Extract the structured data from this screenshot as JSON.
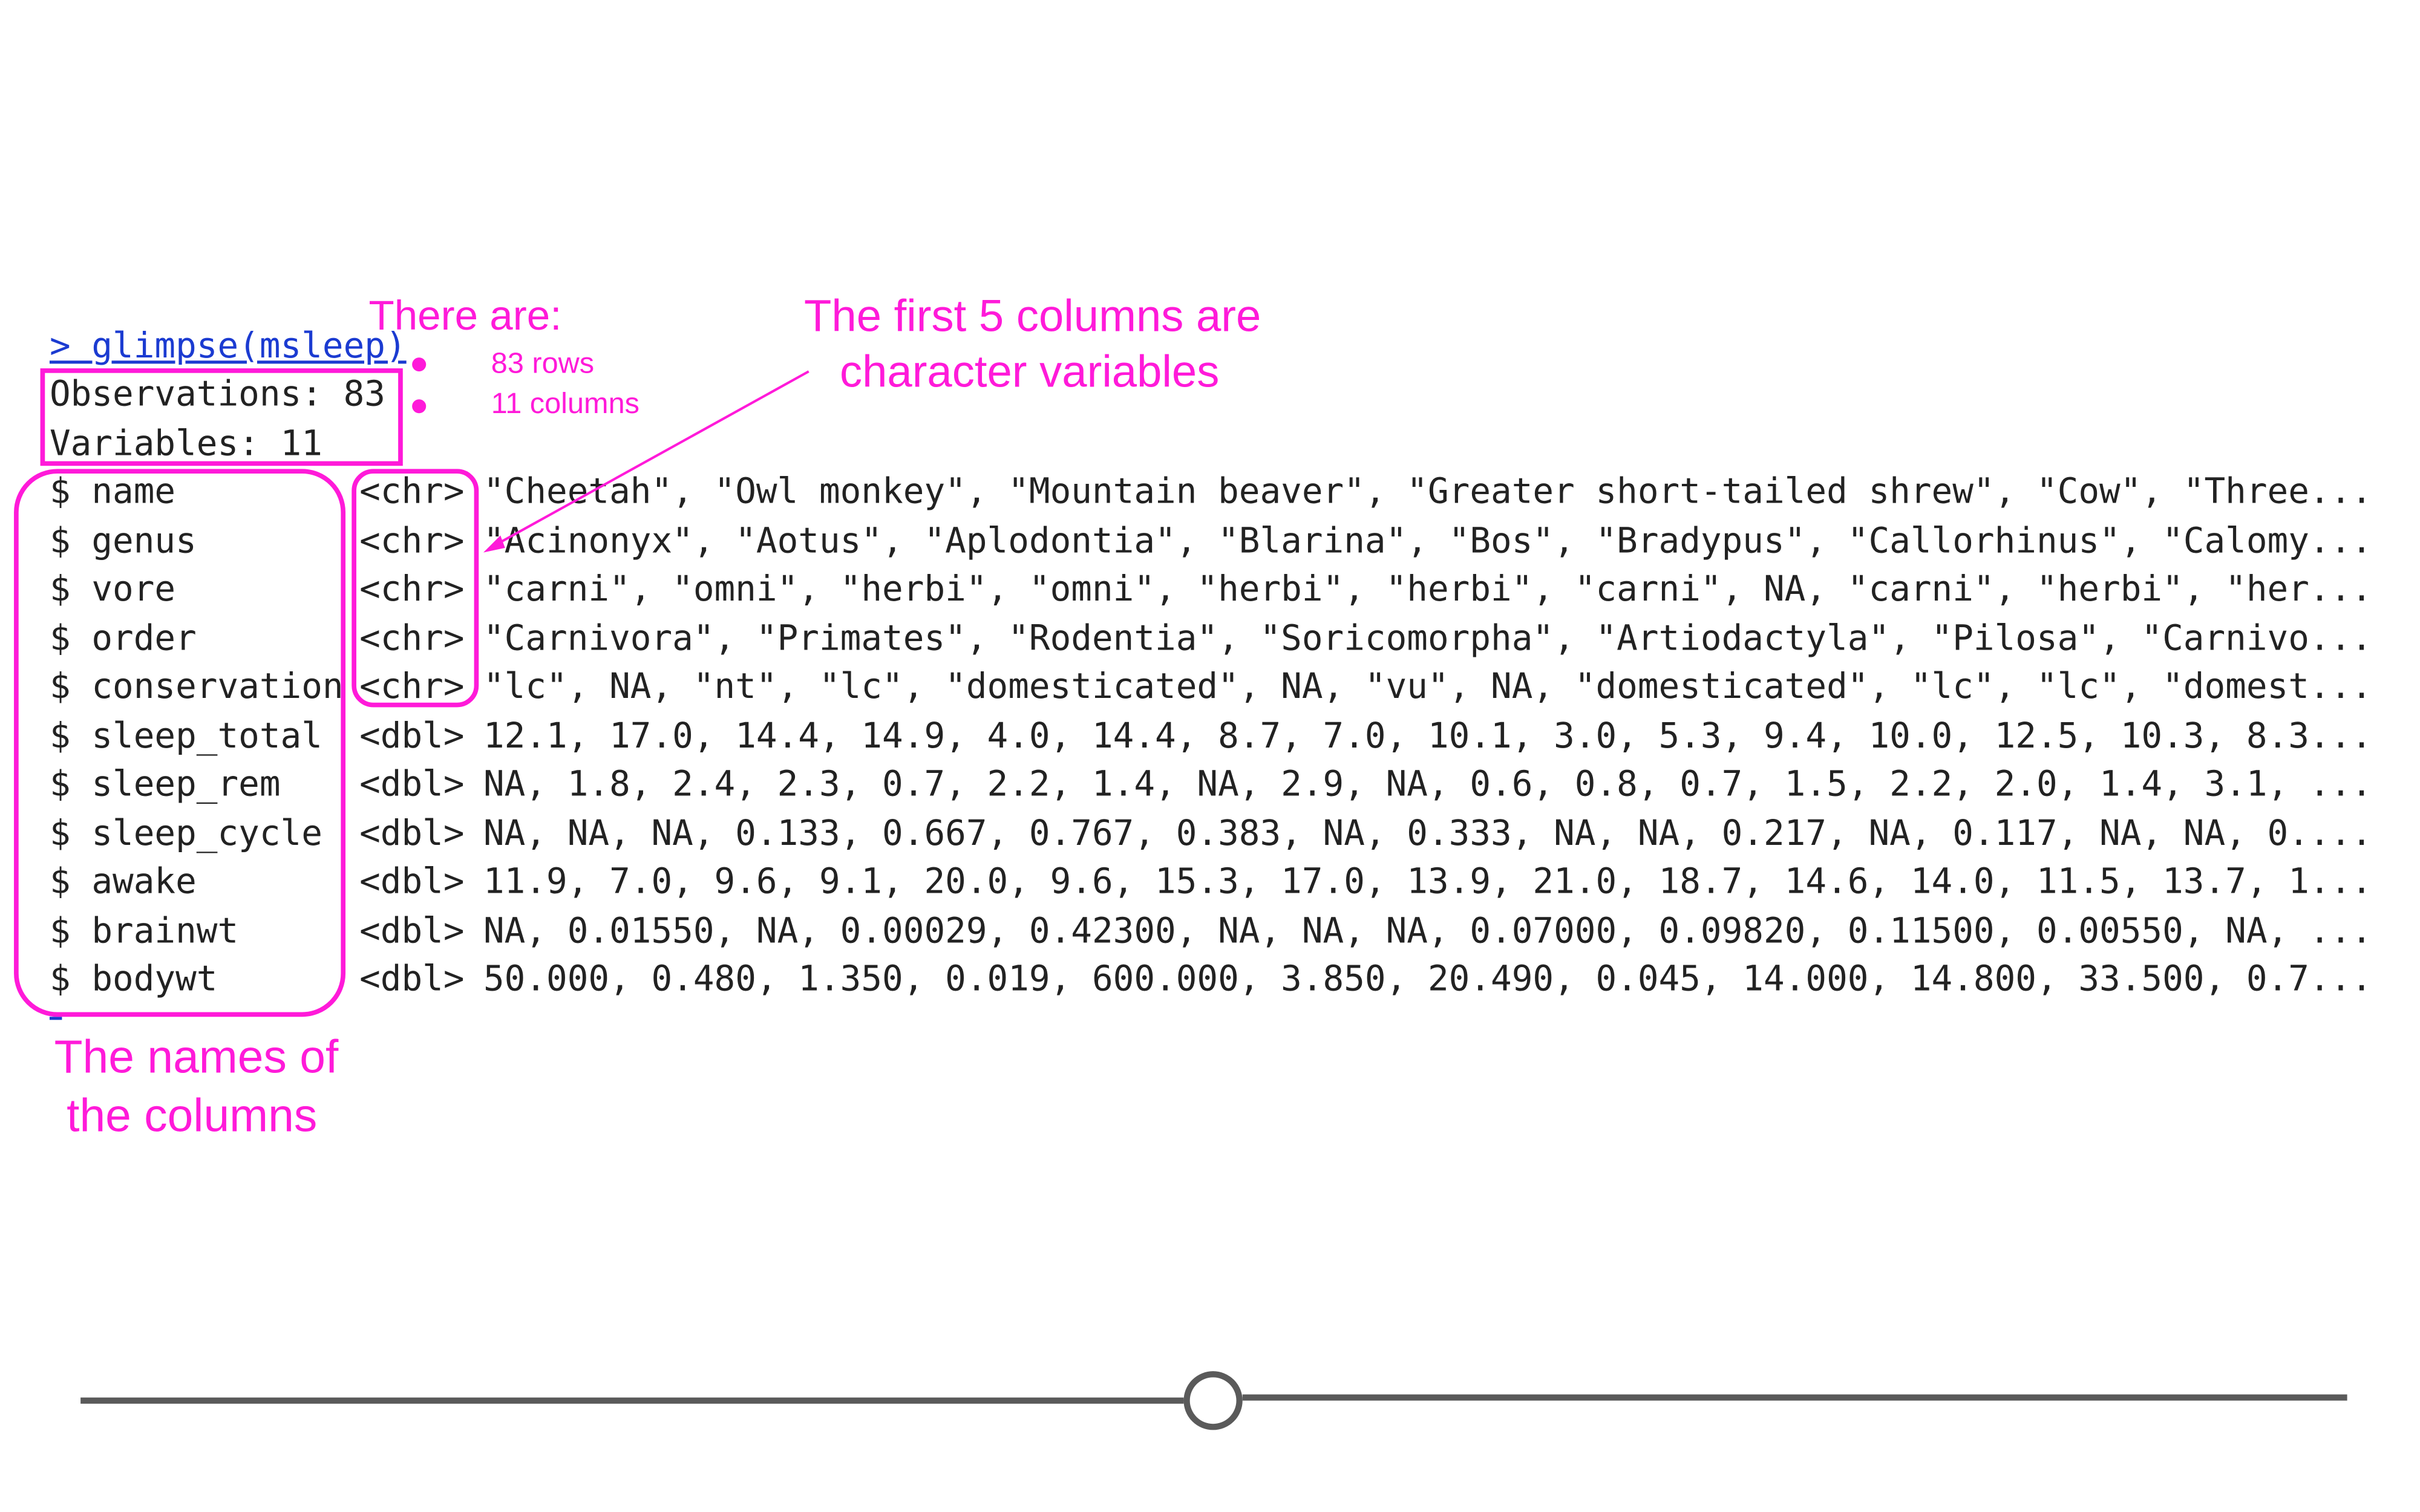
{
  "console": {
    "prompt": "> glimpse(msleep)",
    "observations": "Observations: 83",
    "variables": "Variables: 11",
    "rows": [
      {
        "name": "$ name",
        "type": "<chr>",
        "values": "\"Cheetah\", \"Owl monkey\", \"Mountain beaver\", \"Greater short-tailed shrew\", \"Cow\", \"Three..."
      },
      {
        "name": "$ genus",
        "type": "<chr>",
        "values": "\"Acinonyx\", \"Aotus\", \"Aplodontia\", \"Blarina\", \"Bos\", \"Bradypus\", \"Callorhinus\", \"Calomy..."
      },
      {
        "name": "$ vore",
        "type": "<chr>",
        "values": "\"carni\", \"omni\", \"herbi\", \"omni\", \"herbi\", \"herbi\", \"carni\", NA, \"carni\", \"herbi\", \"her..."
      },
      {
        "name": "$ order",
        "type": "<chr>",
        "values": "\"Carnivora\", \"Primates\", \"Rodentia\", \"Soricomorpha\", \"Artiodactyla\", \"Pilosa\", \"Carnivo..."
      },
      {
        "name": "$ conservation",
        "type": "<chr>",
        "values": "\"lc\", NA, \"nt\", \"lc\", \"domesticated\", NA, \"vu\", NA, \"domesticated\", \"lc\", \"lc\", \"domest..."
      },
      {
        "name": "$ sleep_total",
        "type": "<dbl>",
        "values": "12.1, 17.0, 14.4, 14.9, 4.0, 14.4, 8.7, 7.0, 10.1, 3.0, 5.3, 9.4, 10.0, 12.5, 10.3, 8.3..."
      },
      {
        "name": "$ sleep_rem",
        "type": "<dbl>",
        "values": "NA, 1.8, 2.4, 2.3, 0.7, 2.2, 1.4, NA, 2.9, NA, 0.6, 0.8, 0.7, 1.5, 2.2, 2.0, 1.4, 3.1, ..."
      },
      {
        "name": "$ sleep_cycle",
        "type": "<dbl>",
        "values": "NA, NA, NA, 0.133, 0.667, 0.767, 0.383, NA, 0.333, NA, NA, 0.217, NA, 0.117, NA, NA, 0...."
      },
      {
        "name": "$ awake",
        "type": "<dbl>",
        "values": "11.9, 7.0, 9.6, 9.1, 20.0, 9.6, 15.3, 17.0, 13.9, 21.0, 18.7, 14.6, 14.0, 11.5, 13.7, 1..."
      },
      {
        "name": "$ brainwt",
        "type": "<dbl>",
        "values": "NA, 0.01550, NA, 0.00029, 0.42300, NA, NA, NA, 0.07000, 0.09820, 0.11500, 0.00550, NA, ..."
      },
      {
        "name": "$ bodywt",
        "type": "<dbl>",
        "values": "50.000, 0.480, 1.350, 0.019, 600.000, 3.850, 20.490, 0.045, 14.000, 14.800, 33.500, 0.7..."
      }
    ]
  },
  "annotations": {
    "there_are": "There are:",
    "rows_note": "83 rows",
    "cols_note": "11 columns",
    "first5_line1": "The first 5 columns are",
    "first5_line2": "character variables",
    "names_line1": "The names of",
    "names_line2": "the columns"
  },
  "slider": {
    "value_fraction": 0.5
  },
  "colors": {
    "annotation": "#ff1ad9",
    "prompt": "#1b3bd1",
    "console_text": "#222222",
    "slider": "#5a5a5a"
  }
}
